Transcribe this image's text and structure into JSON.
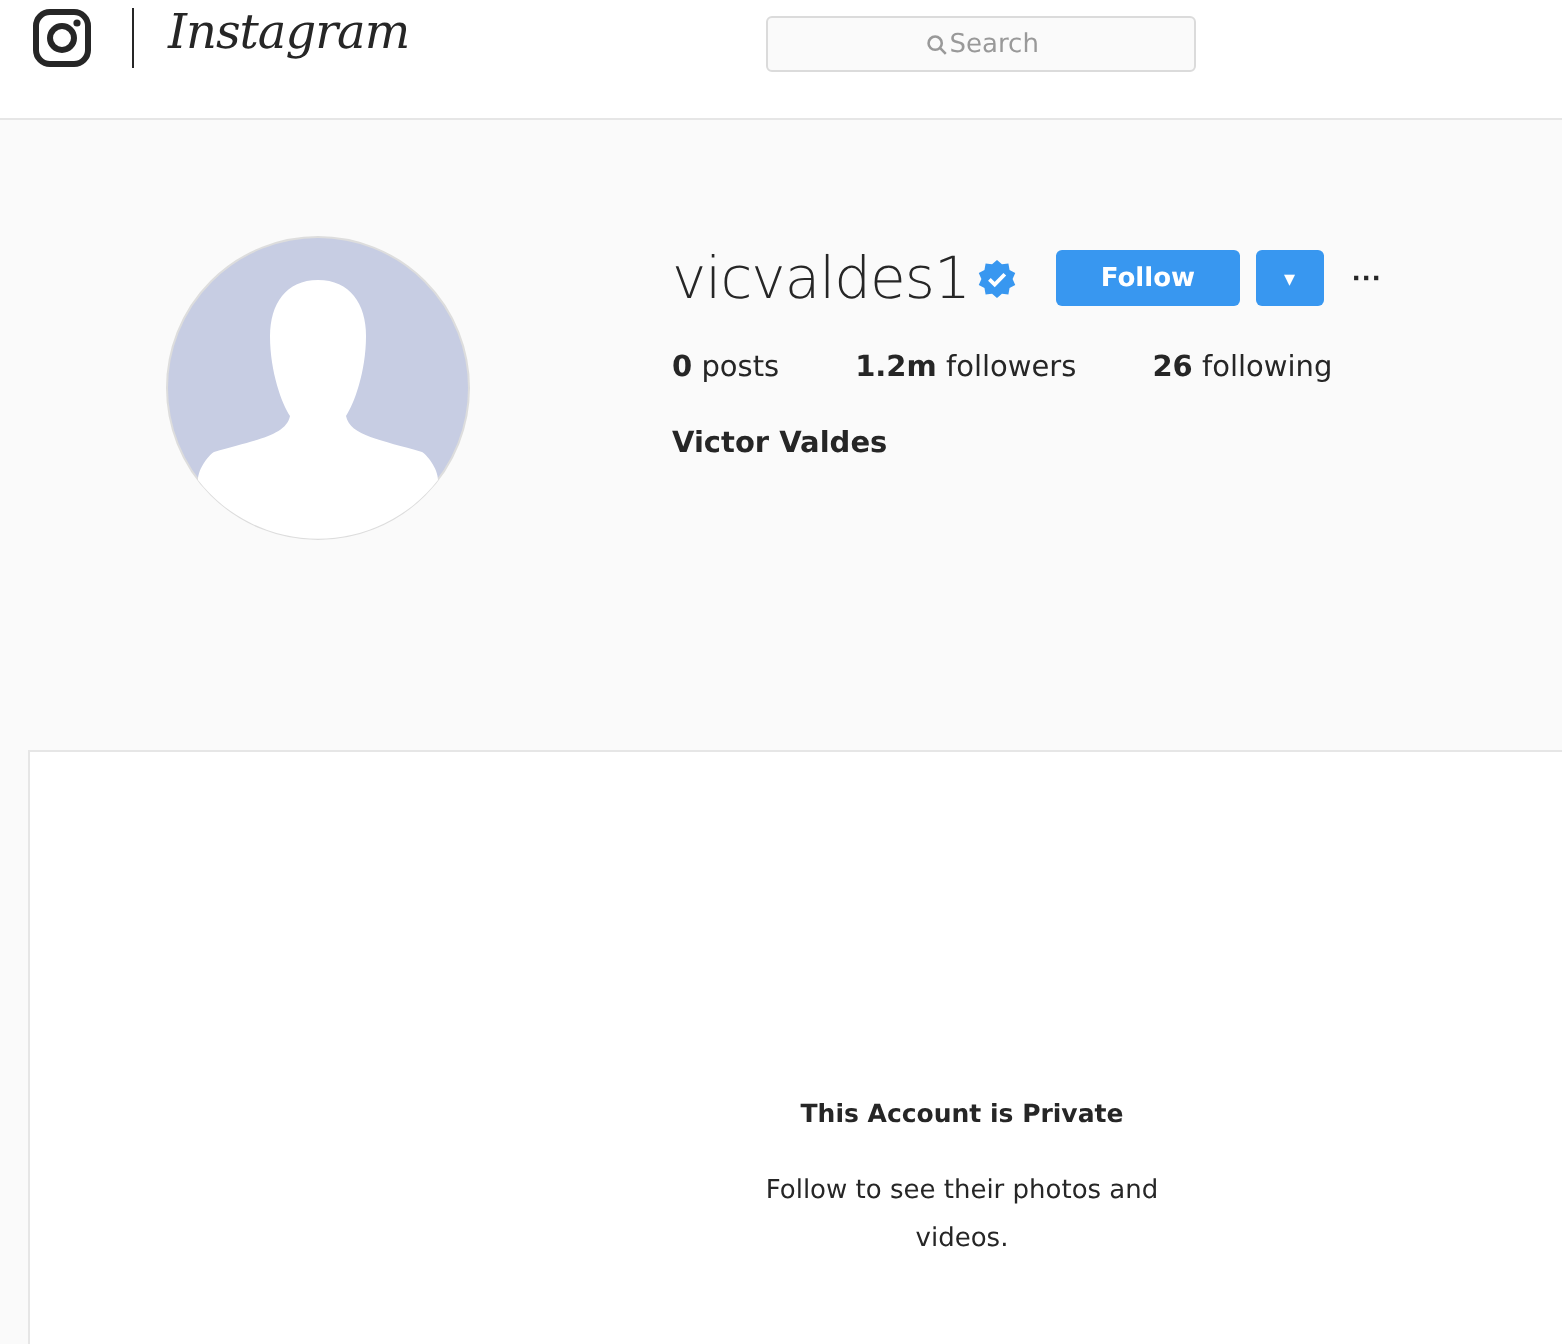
{
  "header": {
    "logo_text": "Instagram",
    "search": {
      "placeholder": "Search"
    }
  },
  "profile": {
    "username": "vicvaldes1",
    "verified": true,
    "follow_button": "Follow",
    "dropdown_button": "▾",
    "more_button": "···",
    "stats": [
      "**0** posts",
      "**1.2m** followers",
      "**26** following"
    ],
    "full_name": "Victor Valdes"
  },
  "private_notice": {
    "title": "This Account is Private",
    "text": "Follow to see their photos and videos."
  }
}
